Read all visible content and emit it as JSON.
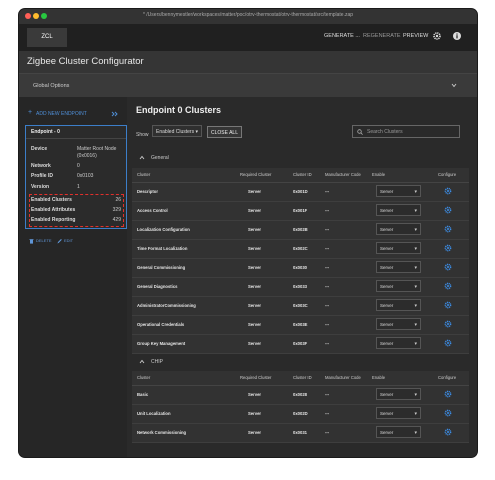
{
  "window": {
    "title": "* /Users/bennymestler/workspaces/matter/poc/otrv-thermostat/otrv-thermostat/src/template.zap"
  },
  "topbar": {
    "tab": "ZCL",
    "generate": "GENERATE ...",
    "regenerate": "REGENERATE",
    "preview": "PREVIEW"
  },
  "header": {
    "title": "Zigbee Cluster Configurator"
  },
  "global": {
    "label": "Global Options"
  },
  "sidebar": {
    "add_endpoint": "ADD NEW ENDPOINT",
    "endpoint_card": {
      "title": "Endpoint - 0",
      "device_label": "Device",
      "device_value_1": "Matter Root Node",
      "device_value_2": "(0x0016)",
      "network_label": "Network",
      "network_value": "0",
      "profile_label": "Profile ID",
      "profile_value": "0x0103",
      "version_label": "Version",
      "version_value": "1",
      "enabled_clusters_label": "Enabled Clusters",
      "enabled_clusters_value": "26",
      "enabled_attributes_label": "Enabled Attributes",
      "enabled_attributes_value": "329",
      "enabled_reporting_label": "Enabled Reporting",
      "enabled_reporting_value": "429",
      "delete_label": "DELETE",
      "edit_label": "EDIT"
    }
  },
  "main": {
    "title": "Endpoint 0 Clusters",
    "show_label": "Show",
    "filter_value": "Enabled Clusters",
    "close_all": "CLOSE ALL",
    "search_placeholder": "Search Clusters",
    "columns": [
      "Cluster",
      "Required Cluster",
      "Cluster ID",
      "Manufacturer Code",
      "Enable",
      "Configure"
    ],
    "groups": [
      {
        "name": "General",
        "rows": [
          {
            "cluster": "Descriptor",
            "required": "Server",
            "id": "0x001D",
            "mfg": "---",
            "enable": "Server"
          },
          {
            "cluster": "Access Control",
            "required": "Server",
            "id": "0x001F",
            "mfg": "---",
            "enable": "Server"
          },
          {
            "cluster": "Localization Configuration",
            "required": "Server",
            "id": "0x002B",
            "mfg": "---",
            "enable": "Server"
          },
          {
            "cluster": "Time Format Localization",
            "required": "Server",
            "id": "0x002C",
            "mfg": "---",
            "enable": "Server"
          },
          {
            "cluster": "General Commissioning",
            "required": "Server",
            "id": "0x0030",
            "mfg": "---",
            "enable": "Server"
          },
          {
            "cluster": "General Diagnostics",
            "required": "Server",
            "id": "0x0033",
            "mfg": "---",
            "enable": "Server"
          },
          {
            "cluster": "AdministratorCommissioning",
            "required": "Server",
            "id": "0x003C",
            "mfg": "---",
            "enable": "Server"
          },
          {
            "cluster": "Operational Credentials",
            "required": "Server",
            "id": "0x003E",
            "mfg": "---",
            "enable": "Server"
          },
          {
            "cluster": "Group Key Management",
            "required": "Server",
            "id": "0x003F",
            "mfg": "---",
            "enable": "Server"
          }
        ]
      },
      {
        "name": "CHIP",
        "rows": [
          {
            "cluster": "Basic",
            "required": "Server",
            "id": "0x0028",
            "mfg": "---",
            "enable": "Server"
          },
          {
            "cluster": "Unit Localization",
            "required": "Server",
            "id": "0x002D",
            "mfg": "---",
            "enable": "Server"
          },
          {
            "cluster": "Network Commissioning",
            "required": "Server",
            "id": "0x0031",
            "mfg": "---",
            "enable": "Server"
          }
        ]
      }
    ]
  },
  "colors": {
    "accent": "#3c7ec9",
    "highlight": "#e0302c",
    "background": "#2a2a2a"
  }
}
